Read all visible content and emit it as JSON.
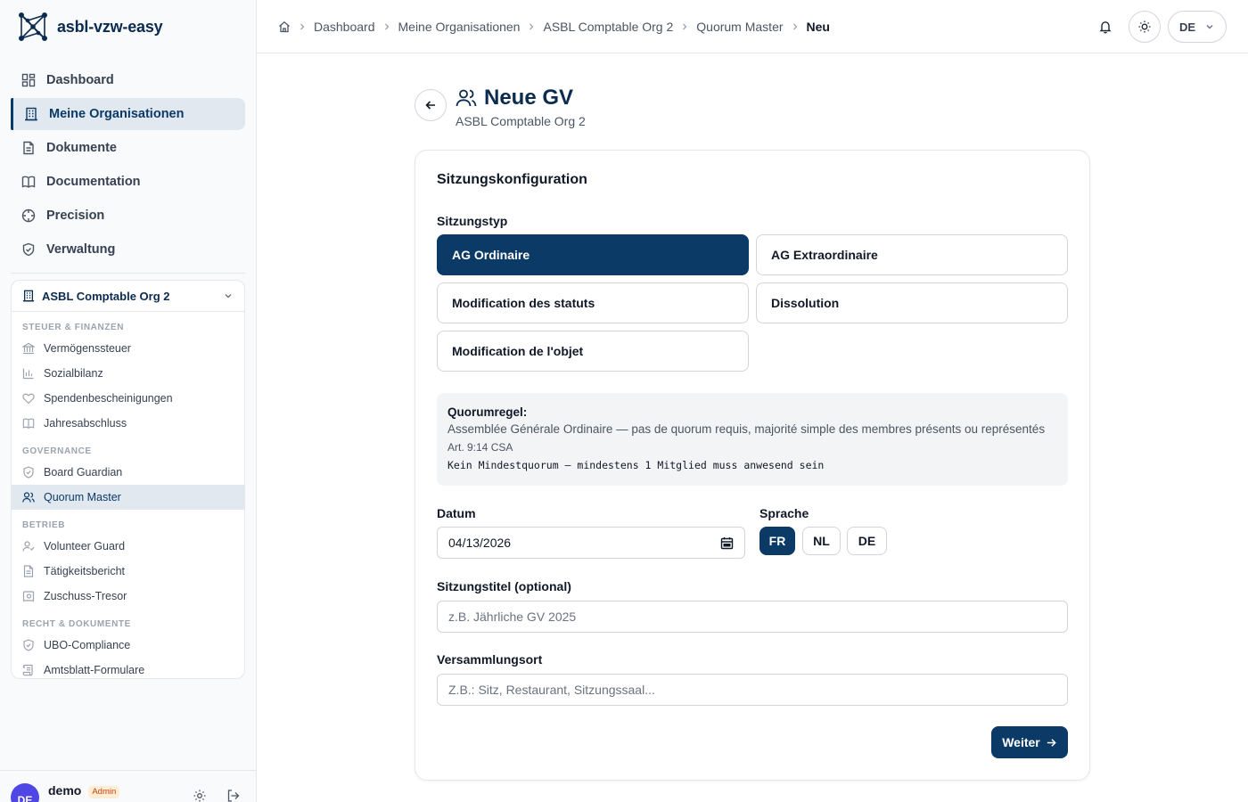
{
  "app": {
    "name": "asbl-vzw-easy"
  },
  "colors": {
    "primary": "#0b3a66",
    "admin_badge": "#c2410c",
    "avatar": "#4f46e5"
  },
  "nav": {
    "items": [
      {
        "label": "Dashboard",
        "icon": "dashboard-icon"
      },
      {
        "label": "Meine Organisationen",
        "icon": "building-icon",
        "active": true
      },
      {
        "label": "Dokumente",
        "icon": "document-icon"
      },
      {
        "label": "Documentation",
        "icon": "book-icon"
      },
      {
        "label": "Precision",
        "icon": "crosshair-icon"
      },
      {
        "label": "Verwaltung",
        "icon": "shield-icon"
      }
    ]
  },
  "org": {
    "name": "ASBL Comptable Org 2",
    "sections": [
      {
        "label": "STEUER & FINANZEN",
        "items": [
          "Vermögenssteuer",
          "Sozialbilanz",
          "Spendenbescheinigungen",
          "Jahresabschluss"
        ]
      },
      {
        "label": "GOVERNANCE",
        "items": [
          "Board Guardian",
          "Quorum Master"
        ]
      },
      {
        "label": "BETRIEB",
        "items": [
          "Volunteer Guard",
          "Tätigkeitsbericht",
          "Zuschuss-Tresor"
        ]
      },
      {
        "label": "RECHT & DOKUMENTE",
        "items": [
          "UBO-Compliance",
          "Amtsblatt-Formulare"
        ]
      }
    ]
  },
  "user": {
    "initials": "DE",
    "name": "demo",
    "role": "Admin"
  },
  "breadcrumb": [
    "Dashboard",
    "Meine Organisationen",
    "ASBL Comptable Org 2",
    "Quorum Master",
    "Neu"
  ],
  "topbar": {
    "language": "DE"
  },
  "page": {
    "title": "Neue GV",
    "subtitle": "ASBL Comptable Org 2"
  },
  "form": {
    "section_title": "Sitzungskonfiguration",
    "type_label": "Sitzungstyp",
    "types": [
      {
        "label": "AG Ordinaire",
        "selected": true
      },
      {
        "label": "AG Extraordinaire"
      },
      {
        "label": "Modification des statuts"
      },
      {
        "label": "Dissolution"
      },
      {
        "label": "Modification de l'objet"
      }
    ],
    "quorum": {
      "title": "Quorumregel:",
      "description": "Assemblée Générale Ordinaire — pas de quorum requis, majorité simple des membres présents ou représentés",
      "reference": "Art. 9:14 CSA",
      "rule": "Kein Mindestquorum — mindestens 1 Mitglied muss anwesend sein"
    },
    "date_label": "Datum",
    "date_value": "04/13/2026",
    "language_label": "Sprache",
    "languages": [
      {
        "label": "FR",
        "selected": true
      },
      {
        "label": "NL"
      },
      {
        "label": "DE"
      }
    ],
    "title_label": "Sitzungstitel (optional)",
    "title_placeholder": "z.B. Jährliche GV 2025",
    "location_label": "Versammlungsort",
    "location_placeholder": "Z.B.: Sitz, Restaurant, Sitzungssaal...",
    "next_label": "Weiter"
  }
}
